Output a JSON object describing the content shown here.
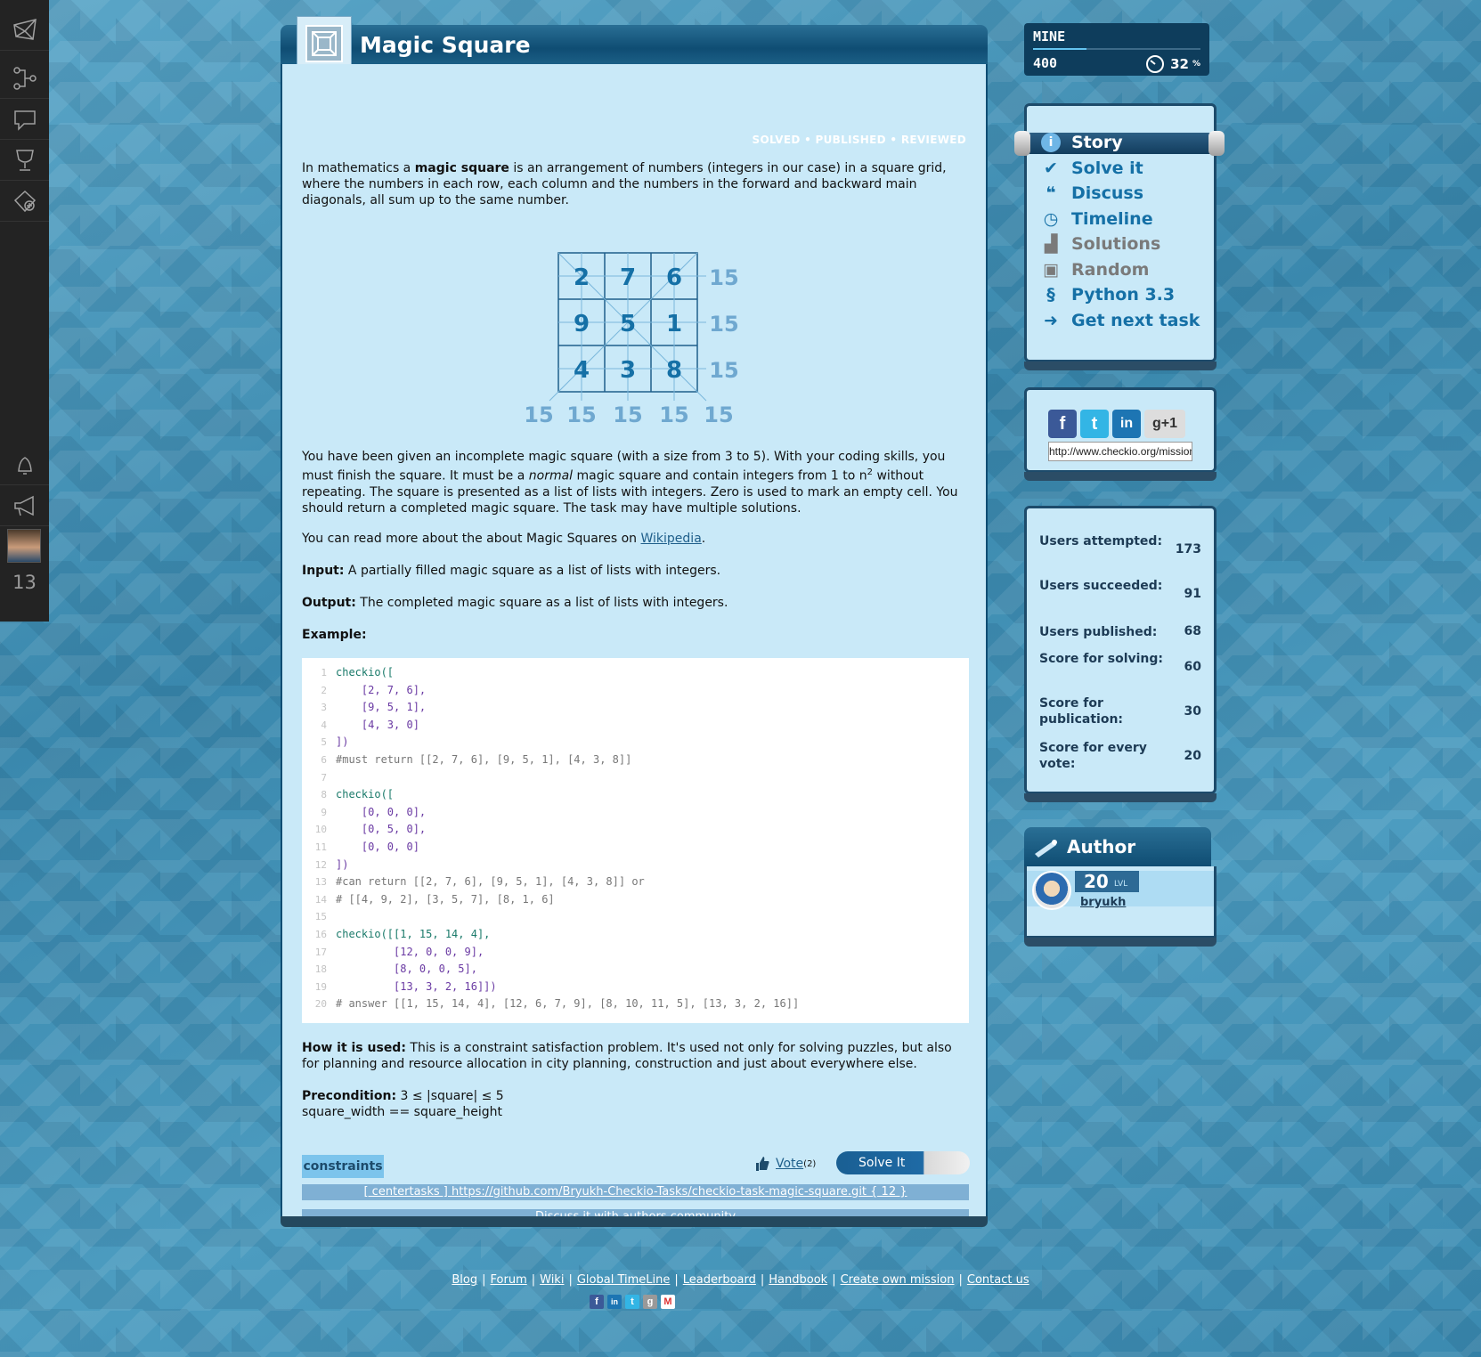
{
  "nav": {
    "level": "13"
  },
  "mission": {
    "title": "Magic Square",
    "status": [
      "SOLVED",
      "PUBLISHED",
      "REVIEWED"
    ],
    "intro": {
      "a": "In mathematics a ",
      "b": "magic square",
      "c": " is an arrangement of numbers (integers in our case) in a square grid, where the numbers in each row, each column and the numbers in the forward and backward main diagonals, all sum up to the same number."
    },
    "figure": {
      "grid": [
        [
          2,
          7,
          6
        ],
        [
          9,
          5,
          1
        ],
        [
          4,
          3,
          8
        ]
      ],
      "row_sums": [
        "15",
        "15",
        "15"
      ],
      "col_sums": [
        "15",
        "15",
        "15",
        "15",
        "15"
      ]
    },
    "p2": {
      "a": "You have been given an incomplete magic square (with a size from 3 to 5). With your coding skills, you must finish the square. It must be a ",
      "i": "normal",
      "b": " magic square and contain integers from 1 to n",
      "sup": "2",
      "c": " without repeating. The square is presented as a list of lists with integers. Zero is used to mark an empty cell. You should return a completed magic square. The task may have multiple solutions."
    },
    "p3": {
      "a": "You can read more about the about Magic Squares on ",
      "link": "Wikipedia",
      "b": "."
    },
    "input": {
      "label": "Input:",
      "text": " A partially filled magic square as a list of lists with integers."
    },
    "output": {
      "label": "Output:",
      "text": " The completed magic square as a list of lists with integers."
    },
    "example_label": "Example:",
    "code": [
      "checkio([",
      "    [2, 7, 6],",
      "    [9, 5, 1],",
      "    [4, 3, 0]",
      "])",
      "#must return [[2, 7, 6], [9, 5, 1], [4, 3, 8]]",
      "",
      "checkio([",
      "    [0, 0, 0],",
      "    [0, 5, 0],",
      "    [0, 0, 0]",
      "])",
      "#can return [[2, 7, 6], [9, 5, 1], [4, 3, 8]] or",
      "# [[4, 9, 2], [3, 5, 7], [8, 1, 6]",
      "",
      "checkio([[1, 15, 14, 4],",
      "         [12, 0, 0, 9],",
      "         [8, 0, 0, 5],",
      "         [13, 3, 2, 16]])",
      "# answer [[1, 15, 14, 4], [12, 6, 7, 9], [8, 10, 11, 5], [13, 3, 2, 16]]"
    ],
    "code_line_numbers": [
      "1",
      "2",
      "3",
      "4",
      "5",
      "6",
      "7",
      "8",
      "9",
      "10",
      "11",
      "12",
      "13",
      "14",
      "15",
      "16",
      "17",
      "18",
      "19",
      "20"
    ],
    "how_used": {
      "label": "How it is used:",
      "text": " This is a constraint satisfaction problem. It's used not only for solving puzzles, but also for planning and resource allocation in city planning, construction and just about everywhere else."
    },
    "precondition": {
      "label": "Precondition:",
      "line1": " 3 ≤ |square| ≤ 5",
      "line2": "square_width == square_height"
    },
    "tag": "constraints",
    "vote_label": "Vote",
    "vote_count": "(2)",
    "solve_label": "Solve It",
    "repo_link": "[ centertasks ] https://github.com/Bryukh-Checkio-Tasks/checkio-task-magic-square.git { 12 }",
    "discuss_link": "Discuss it with authors community"
  },
  "mine": {
    "label": "MINE",
    "score": "400",
    "percent": "32",
    "percent_sign": "%",
    "progress": 0.32
  },
  "menu": [
    {
      "label": "Story",
      "icon": "info-icon",
      "active": true
    },
    {
      "label": "Solve it",
      "icon": "checkmark-icon"
    },
    {
      "label": "Discuss",
      "icon": "chat-bubbles-icon"
    },
    {
      "label": "Timeline",
      "icon": "clock-icon"
    },
    {
      "label": "Solutions",
      "icon": "podium-icon",
      "dim": true
    },
    {
      "label": "Random",
      "icon": "cube-icon",
      "dim": true
    },
    {
      "label": "Python 3.3",
      "icon": "python-icon"
    },
    {
      "label": "Get next task",
      "icon": "arrow-right-icon"
    }
  ],
  "share": {
    "url": "http://www.checkio.org/mission/magic-square/"
  },
  "stats": [
    {
      "label": "Users attempted:",
      "value": "173"
    },
    {
      "label": "Users succeeded:",
      "value": "91"
    },
    {
      "label": "Users published:",
      "value": "68"
    },
    {
      "label": "Score for solving:",
      "value": "60"
    },
    {
      "label": "Score for publication:",
      "value": "30"
    },
    {
      "label": "Score for every vote:",
      "value": "20"
    }
  ],
  "author": {
    "title": "Author",
    "level": "20",
    "level_label": "LVL",
    "name": "bryukh"
  },
  "footer": {
    "links": [
      "Blog",
      "Forum",
      "Wiki",
      "Global TimeLine",
      "Leaderboard",
      "Handbook",
      "Create own mission",
      "Contact us"
    ]
  },
  "colors": {
    "accent": "#1570a6",
    "panel_bg": "#c9e9f8",
    "header": "#0f4d73"
  }
}
